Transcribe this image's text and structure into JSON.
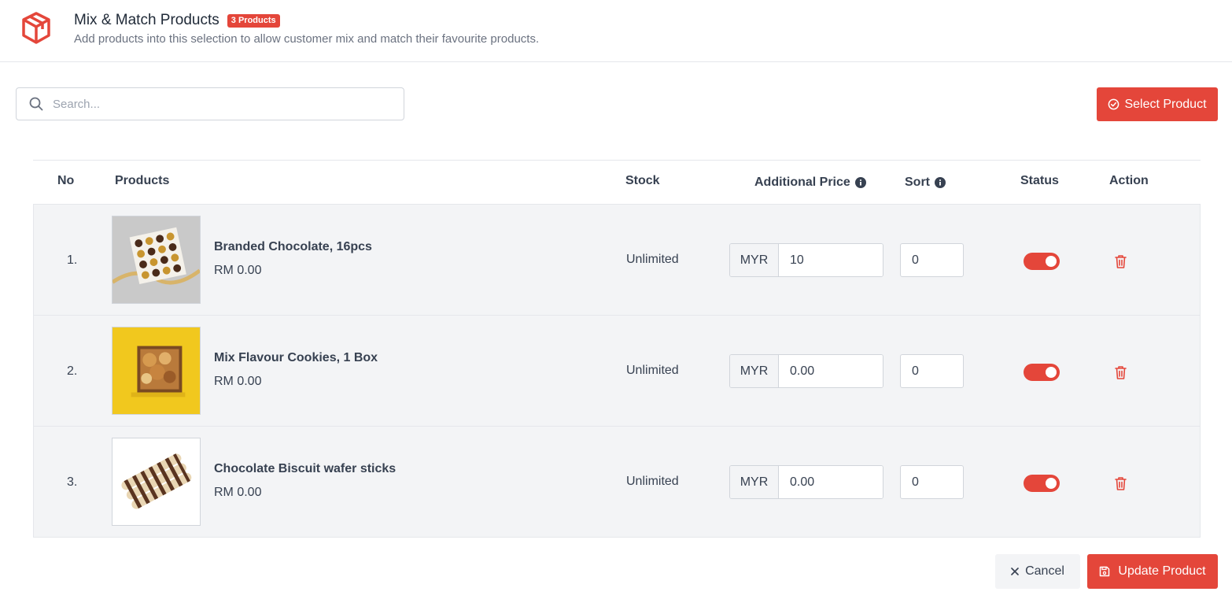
{
  "header": {
    "title": "Mix & Match Products",
    "badge": "3 Products",
    "subtitle": "Add products into this selection to allow customer mix and match their favourite products."
  },
  "search": {
    "placeholder": "Search...",
    "value": ""
  },
  "toolbar": {
    "select_label": "Select Product"
  },
  "table": {
    "headers": {
      "no": "No",
      "products": "Products",
      "stock": "Stock",
      "additional_price": "Additional Price",
      "sort": "Sort",
      "status": "Status",
      "action": "Action"
    },
    "rows": [
      {
        "no": "1.",
        "name": "Branded Chocolate, 16pcs",
        "price": "RM 0.00",
        "stock": "Unlimited",
        "currency": "MYR",
        "additional_price": "10",
        "sort": "0",
        "status_on": true
      },
      {
        "no": "2.",
        "name": "Mix Flavour Cookies, 1 Box",
        "price": "RM 0.00",
        "stock": "Unlimited",
        "currency": "MYR",
        "additional_price": "0.00",
        "sort": "0",
        "status_on": true
      },
      {
        "no": "3.",
        "name": "Chocolate Biscuit wafer sticks",
        "price": "RM 0.00",
        "stock": "Unlimited",
        "currency": "MYR",
        "additional_price": "0.00",
        "sort": "0",
        "status_on": true
      }
    ]
  },
  "footer": {
    "cancel_label": "Cancel",
    "update_label": "Update Product"
  },
  "colors": {
    "accent": "#e4463a",
    "row_bg": "#f3f4f6"
  },
  "icons": [
    "box-logo-icon",
    "search-icon",
    "check-circle-icon",
    "info-icon",
    "trash-icon",
    "close-icon",
    "save-icon"
  ]
}
